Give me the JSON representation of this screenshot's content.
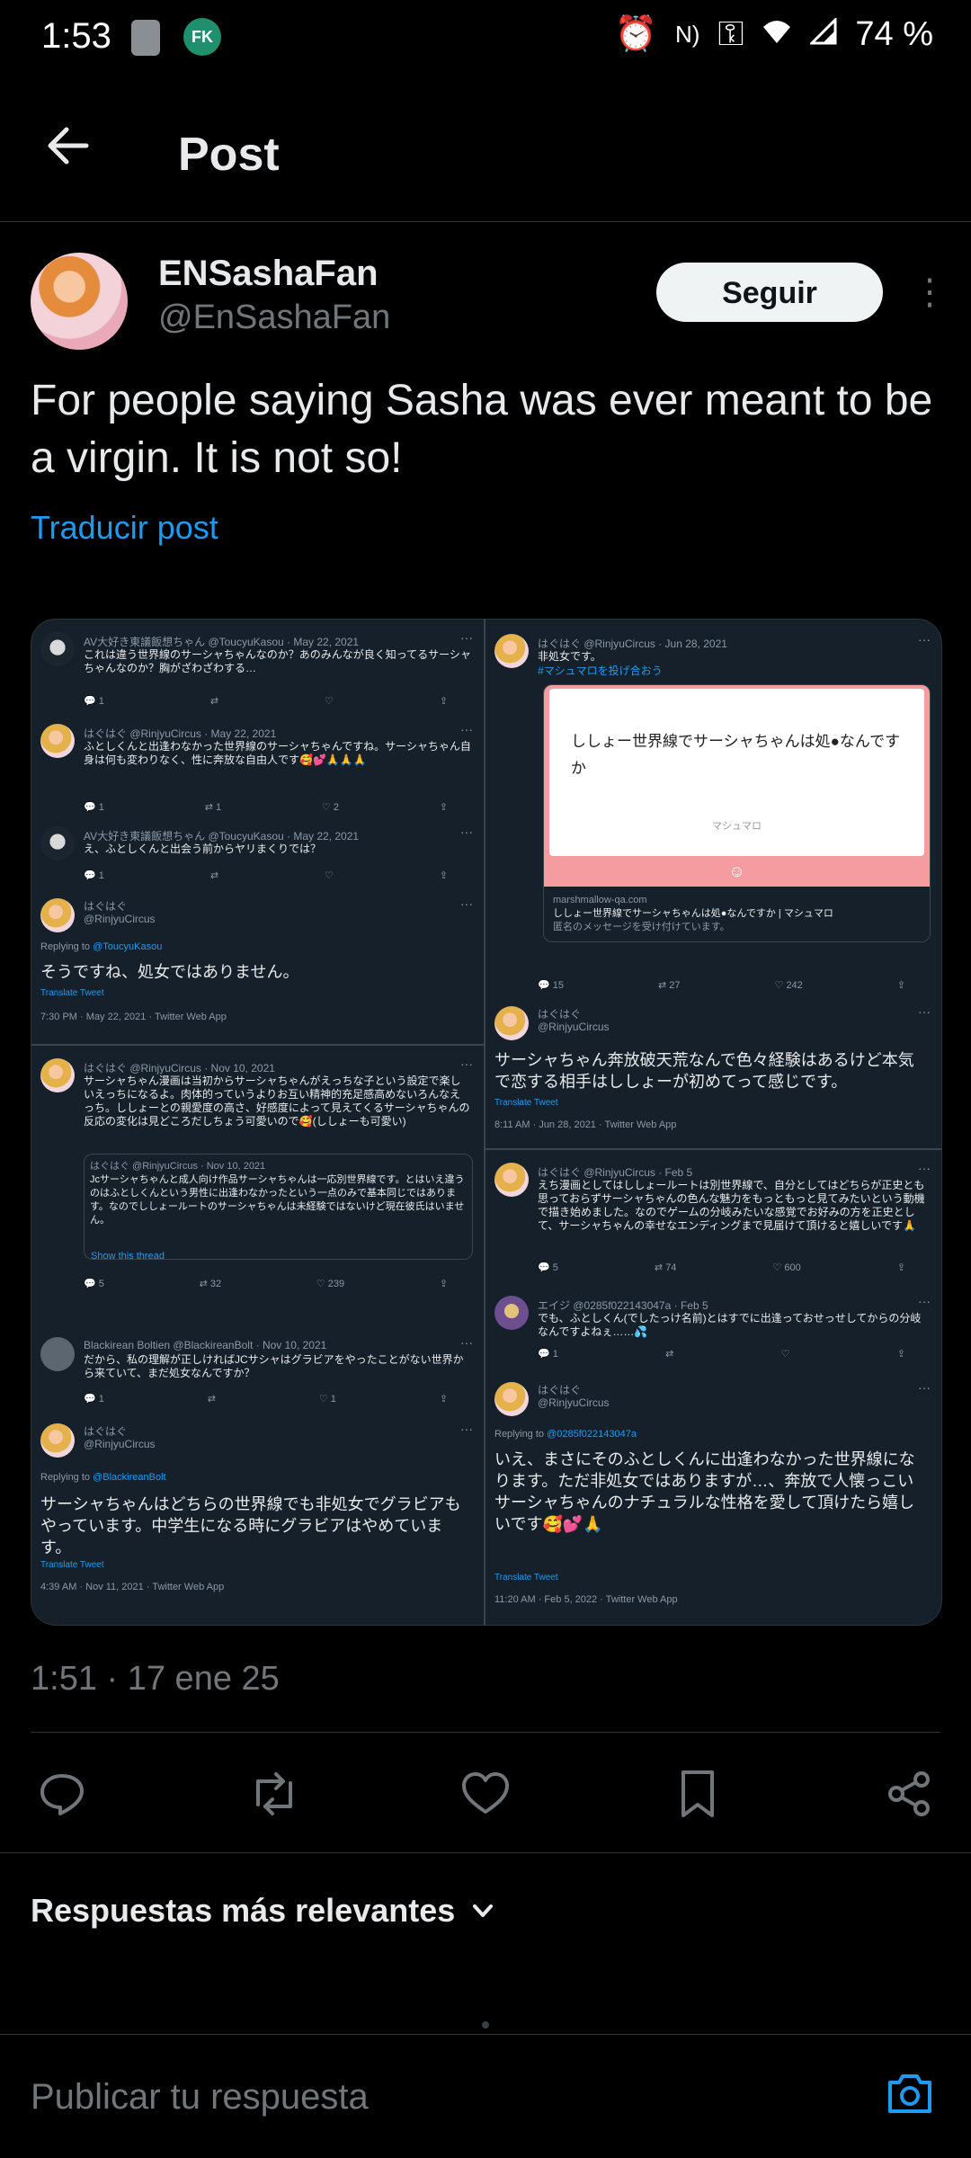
{
  "status_bar": {
    "time": "1:53",
    "app_badge": "FK",
    "battery": "74 %",
    "icons": [
      "alarm-icon",
      "nfc-icon",
      "vpn-key-icon",
      "wifi-icon",
      "signal-icon"
    ]
  },
  "header": {
    "title": "Post",
    "back_icon": "arrow-left-icon"
  },
  "author": {
    "name": "ENSashaFan",
    "handle": "@EnSashaFan",
    "follow_label": "Seguir"
  },
  "post": {
    "text": "For people saying Sasha was ever meant to be a virgin. It is not so!",
    "translate_label": "Traducir post",
    "timestamp": "1:51 · 17 ene 25"
  },
  "media": {
    "left": {
      "t1": {
        "meta": "AV大好き東議飯想ちゃん @ToucyuKasou · May 22, 2021",
        "body": "これは違う世界線のサーシャちゃんなのか？あのみんなが良く知ってるサーシャちゃんなのか？胸がざわざわする…",
        "acts": [
          "1",
          "",
          "",
          ""
        ]
      },
      "t2": {
        "meta": "はぐはぐ @RinjyuCircus · May 22, 2021",
        "body": "ふとしくんと出逢わなかった世界線のサーシャちゃんですね。サーシャちゃん自身は何も変わりなく、性に奔放な自由人です🥰💕🙏🙏🙏",
        "acts": [
          "1",
          "1",
          "2",
          ""
        ]
      },
      "t3": {
        "meta": "AV大好き東議飯想ちゃん @ToucyuKasou · May 22, 2021",
        "body": "え、ふとしくんと出会う前からヤリまくりでは？",
        "acts": [
          "1",
          "",
          "",
          ""
        ]
      },
      "t4": {
        "meta": "はぐはぐ",
        "meta2": "@RinjyuCircus",
        "reply_to_label": "Replying to",
        "reply_to": "@ToucyuKasou",
        "body": "そうですね、処女ではありません。",
        "translate": "Translate Tweet",
        "stamp": "7:30 PM · May 22, 2021 · Twitter Web App"
      },
      "t5": {
        "meta": "はぐはぐ @RinjyuCircus · Nov 10, 2021",
        "body": "サーシャちゃん漫画は当初からサーシャちゃんがえっちな子という設定で楽しいえっちになるよ。肉体的っていうよりお互い精神的充足感高めないろんなえっち。ししょーとの親愛度の高さ、好感度によって見えてくるサーシャちゃんの反応の変化は見どころだしちょう可愛いので🥰(ししょーも可愛い)",
        "quote_meta": "はぐはぐ @RinjyuCircus · Nov 10, 2021",
        "quote_body": "Jcサーシャちゃんと成人向け作品サーシャちゃんは一応別世界線です。とはいえ違うのはふとしくんという男性に出逢わなかったという一点のみで基本同じではあります。なのでししょールートのサーシャちゃんは未経験ではないけど現在彼氏はいません。",
        "show_thread": "Show this thread",
        "acts": [
          "5",
          "32",
          "239",
          ""
        ]
      },
      "t6": {
        "meta": "Blackirean Boltien @BlackireanBolt · Nov 10, 2021",
        "body": "だから、私の理解が正しければJCサシャはグラビアをやったことがない世界から来ていて、まだ処女なんですか？",
        "acts": [
          "1",
          "",
          "1",
          ""
        ]
      },
      "t7": {
        "meta": "はぐはぐ",
        "meta2": "@RinjyuCircus",
        "reply_to_label": "Replying to",
        "reply_to": "@BlackireanBolt",
        "body": "サーシャちゃんはどちらの世界線でも非処女でグラビアもやっています。中学生になる時にグラビアはやめています。",
        "translate": "Translate Tweet",
        "stamp": "4:39 AM · Nov 11, 2021 · Twitter Web App"
      }
    },
    "right": {
      "t1": {
        "meta": "はぐはぐ @RinjyuCircus · Jun 28, 2021",
        "body": "非処女です。",
        "hashtag": "#マシュマロを投げ合おう",
        "card_text": "ししょー世界線でサーシャちゃんは処●なんですか",
        "card_brand": "マシュマロ",
        "card_domain": "marshmallow-qa.com",
        "card_title": "ししょー世界線でサーシャちゃんは処●なんですか | マシュマロ",
        "card_desc": "匿名のメッセージを受け付けています。",
        "acts": [
          "15",
          "27",
          "242",
          ""
        ]
      },
      "t2": {
        "meta": "はぐはぐ",
        "meta2": "@RinjyuCircus",
        "body": "サーシャちゃん奔放破天荒なんで色々経験はあるけど本気で恋する相手はししょーが初めてって感じです。",
        "translate": "Translate Tweet",
        "stamp": "8:11 AM · Jun 28, 2021 · Twitter Web App"
      },
      "t3": {
        "meta": "はぐはぐ @RinjyuCircus · Feb 5",
        "body": "えち漫画としてはししょールートは別世界線で、自分としてはどちらが正史とも思っておらずサーシャちゃんの色んな魅力をもっともっと見てみたいという動機で描き始めました。なのでゲームの分岐みたいな感覚でお好みの方を正史として、サーシャちゃんの幸せなエンディングまで見届けて頂けると嬉しいです🙏",
        "acts": [
          "5",
          "74",
          "600",
          ""
        ]
      },
      "t4": {
        "meta": "エイジ @0285f022143047a · Feb 5",
        "body": "でも、ふとしくん(でしたっけ名前)とはすでに出逢っておせっせしてからの分岐なんですよねぇ……💦",
        "acts": [
          "1",
          "",
          "",
          ""
        ]
      },
      "t5": {
        "meta": "はぐはぐ",
        "meta2": "@RinjyuCircus",
        "reply_to_label": "Replying to",
        "reply_to": "@0285f022143047a",
        "body": "いえ、まさにそのふとしくんに出逢わなかった世界線になります。ただ非処女ではありますが…、奔放で人懐っこいサーシャちゃんのナチュラルな性格を愛して頂けたら嬉しいです🥰💕🙏",
        "translate": "Translate Tweet",
        "stamp": "11:20 AM · Feb 5, 2022 · Twitter Web App"
      }
    }
  },
  "actions": {
    "icons": [
      "reply-icon",
      "repost-icon",
      "like-icon",
      "bookmark-icon",
      "share-icon"
    ]
  },
  "replies": {
    "sort_label": "Respuestas más relevantes",
    "placeholder": "Publicar tu respuesta"
  },
  "colors": {
    "accent": "#1d9bf0",
    "background": "#000000",
    "muted": "#71767b",
    "card_bg": "#15202b"
  }
}
